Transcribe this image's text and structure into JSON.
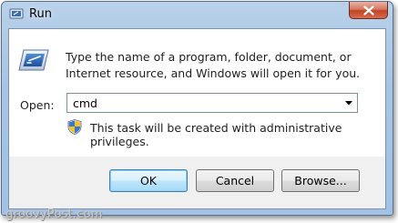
{
  "window": {
    "title": "Run",
    "title_icon": "run-app-icon",
    "close_icon": "close-icon"
  },
  "dialog": {
    "icon": "run-dialog-icon",
    "description": "Type the name of a program, folder, document, or Internet resource, and Windows will open it for you.",
    "open_label": "Open:",
    "open_value": "cmd",
    "dropdown_icon": "chevron-down-icon",
    "shield_icon": "uac-shield-icon",
    "admin_note": "This task will be created with administrative privileges."
  },
  "buttons": {
    "ok": "OK",
    "cancel": "Cancel",
    "browse": "Browse..."
  },
  "watermark": "groovyPost.com",
  "colors": {
    "titlebar": "#a7c4e3",
    "close_button": "#c14426",
    "default_button_border": "#3c7fb1",
    "client_background": "#f0f0f0"
  }
}
